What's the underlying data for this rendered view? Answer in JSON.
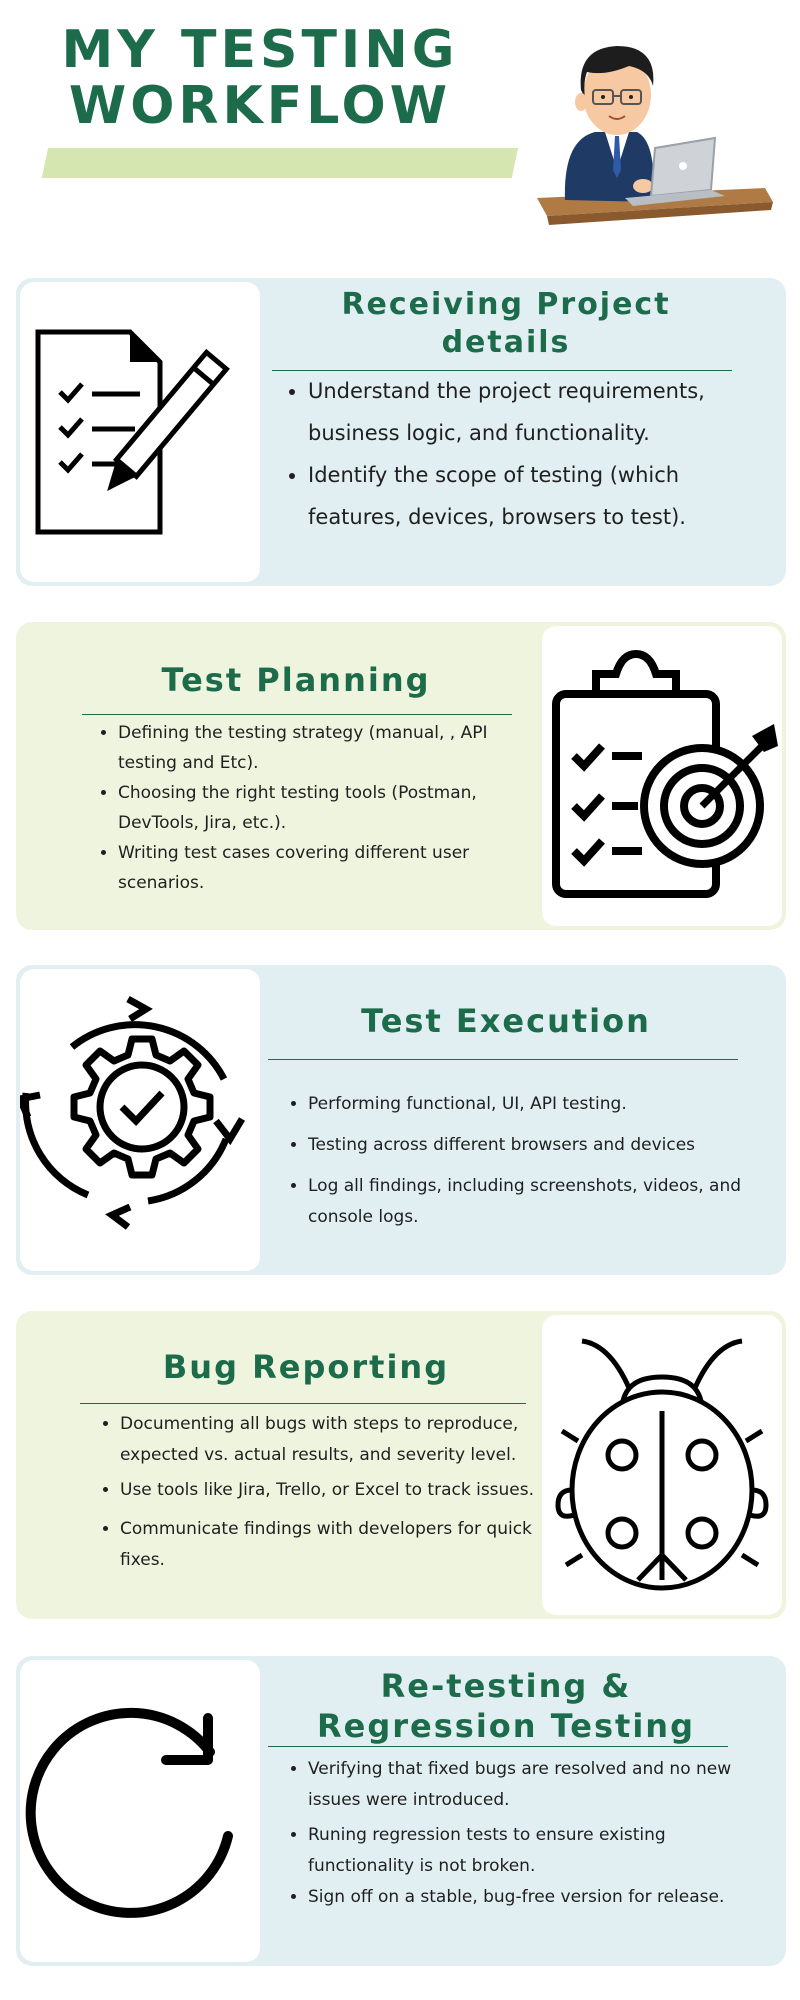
{
  "header": {
    "title_line1": "MY TESTING",
    "title_line2": "WORKFLOW"
  },
  "sections": [
    {
      "title": "Receiving Project details",
      "bullets": [
        "Understand the project requirements, business logic, and functionality.",
        "Identify the scope of testing (which features, devices, browsers to test)."
      ],
      "icon": "checklist-pencil-icon"
    },
    {
      "title": "Test Planning",
      "bullets": [
        "Defining the testing strategy (manual, , API testing and Etc).",
        "Choosing the right testing tools (Postman, DevTools, Jira, etc.).",
        "Writing test cases covering different user scenarios."
      ],
      "icon": "clipboard-target-icon"
    },
    {
      "title": "Test Execution",
      "bullets": [
        "Performing functional, UI, API  testing.",
        "Testing across different browsers and devices",
        "Log all findings, including screenshots, videos, and console logs."
      ],
      "icon": "gear-check-cycle-icon"
    },
    {
      "title": "Bug Reporting",
      "bullets": [
        "Documenting all bugs with steps to reproduce, expected vs. actual results, and severity level.",
        "Use tools like Jira, Trello, or Excel to track issues.",
        "Communicate findings with developers for quick fixes."
      ],
      "icon": "bug-icon"
    },
    {
      "title": "Re-testing & Regression Testing",
      "bullets": [
        "Verifying that fixed bugs are resolved and no new issues were introduced.",
        "Runing regression tests to ensure existing functionality is not broken.",
        "Sign off on a stable, bug-free version for release."
      ],
      "icon": "refresh-arrow-icon"
    }
  ],
  "colors": {
    "title_green": "#1c6b4a",
    "card_blue": "#e1eff2",
    "card_green": "#eff4df",
    "highlight": "#d6e6b1"
  }
}
